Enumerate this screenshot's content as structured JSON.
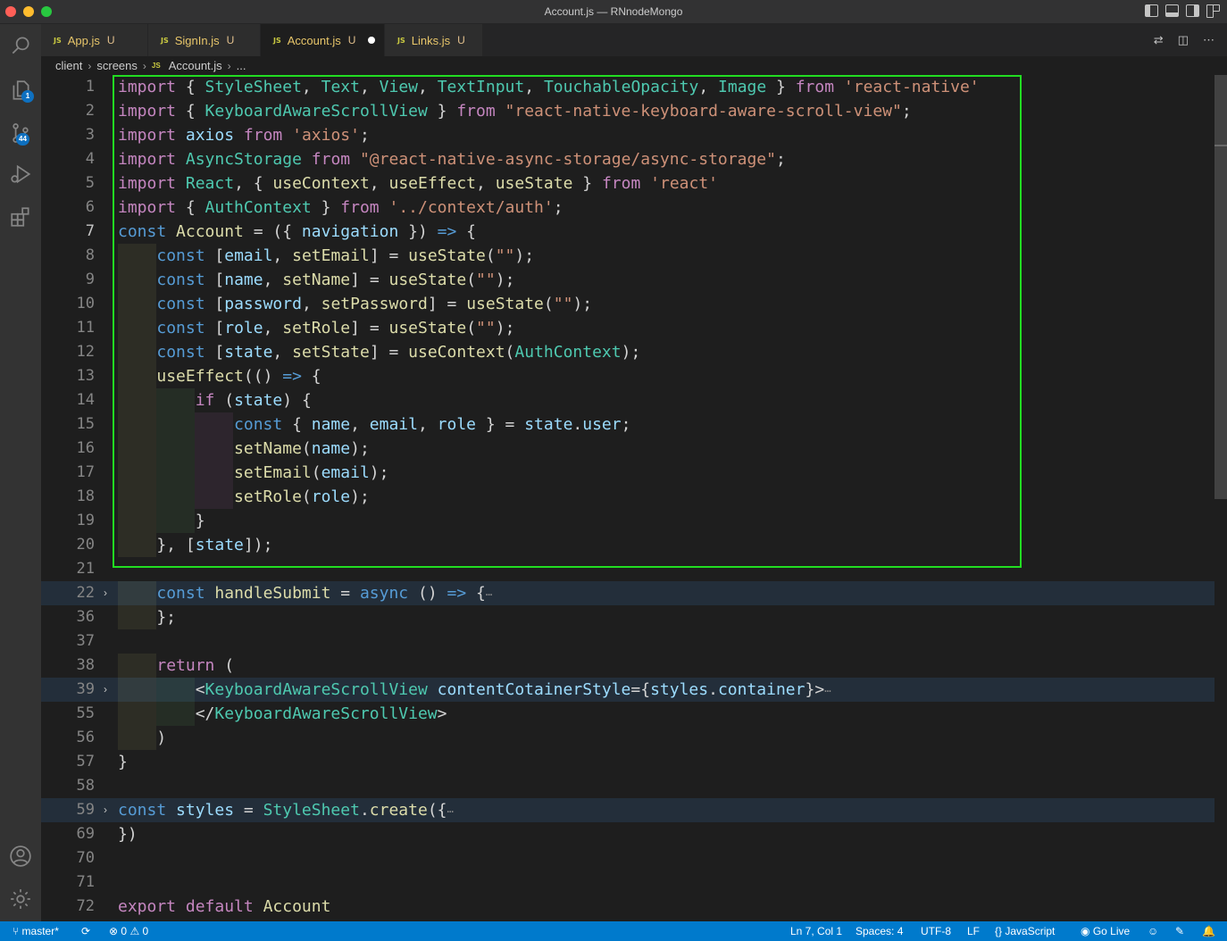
{
  "window": {
    "title": "Account.js — RNnodeMongo"
  },
  "activity_bar": {
    "items": [
      "search-icon",
      "files-icon",
      "source-control-icon",
      "run-debug-icon",
      "extensions-icon",
      "account-icon",
      "manage-gear-icon"
    ],
    "explorer_badge": "1",
    "source_control_badge": "44"
  },
  "tabs": [
    {
      "icon": "JS",
      "label": "App.js",
      "status": "U"
    },
    {
      "icon": "JS",
      "label": "SignIn.js",
      "status": "U"
    },
    {
      "icon": "JS",
      "label": "Account.js",
      "status": "U",
      "modified": true,
      "active": true
    },
    {
      "icon": "JS",
      "label": "Links.js",
      "status": "U"
    }
  ],
  "breadcrumb": {
    "parts": [
      "client",
      "screens",
      "Account.js",
      "..."
    ],
    "file_icon": "JS"
  },
  "editor": {
    "line_numbers": [
      "1",
      "2",
      "3",
      "4",
      "5",
      "6",
      "7",
      "8",
      "9",
      "10",
      "11",
      "12",
      "13",
      "14",
      "15",
      "16",
      "17",
      "18",
      "19",
      "20",
      "21",
      "22",
      "36",
      "37",
      "38",
      "39",
      "55",
      "56",
      "57",
      "58",
      "59",
      "69",
      "70",
      "71",
      "72"
    ],
    "active_line": "7",
    "lines": [
      "import { StyleSheet, Text, View, TextInput, TouchableOpacity, Image } from 'react-native'",
      "import { KeyboardAwareScrollView } from \"react-native-keyboard-aware-scroll-view\";",
      "import axios from 'axios';",
      "import AsyncStorage from \"@react-native-async-storage/async-storage\";",
      "import React, { useContext, useEffect, useState } from 'react'",
      "import { AuthContext } from '../context/auth';",
      "const Account = ({ navigation }) => {",
      "    const [email, setEmail] = useState(\"\");",
      "    const [name, setName] = useState(\"\");",
      "    const [password, setPassword] = useState(\"\");",
      "    const [role, setRole] = useState(\"\");",
      "    const [state, setState] = useContext(AuthContext);",
      "    useEffect(() => {",
      "        if (state) {",
      "            const { name, email, role } = state.user;",
      "            setName(name);",
      "            setEmail(email);",
      "            setRole(role);",
      "        }",
      "    }, [state]);",
      "",
      "    const handleSubmit = async () => {",
      "    };",
      "",
      "    return (",
      "        <KeyboardAwareScrollView contentCotainerStyle={styles.container}>",
      "        </KeyboardAwareScrollView>",
      "    )",
      "}",
      "",
      "const styles = StyleSheet.create({",
      "})",
      "",
      "",
      "export default Account"
    ]
  },
  "status_bar": {
    "branch": "master*",
    "errors": "0",
    "warnings": "0",
    "cursor": "Ln 7, Col 1",
    "spaces": "Spaces: 4",
    "encoding": "UTF-8",
    "eol": "LF",
    "language": "JavaScript",
    "go_live": "Go Live"
  },
  "colors": {
    "accent": "#007acc",
    "selection_highlight": "#22dd22",
    "tab_label": "#e8c66a"
  }
}
